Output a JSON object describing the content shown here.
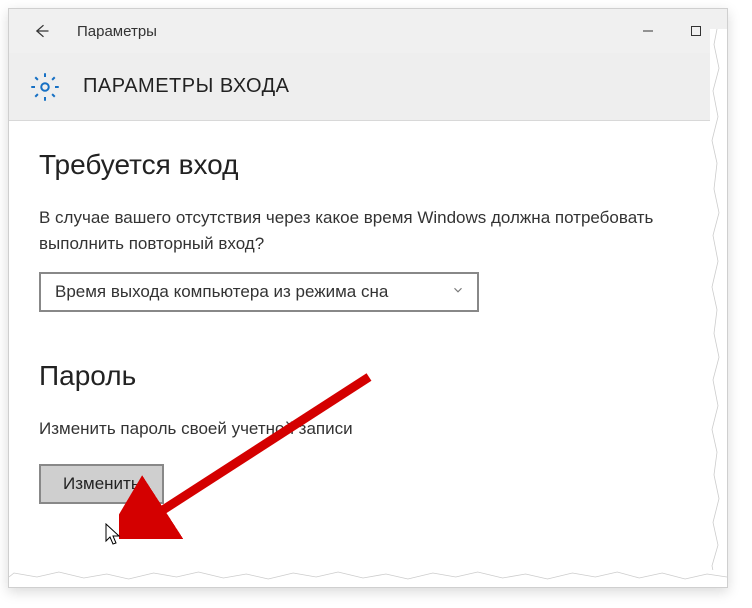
{
  "titlebar": {
    "title": "Параметры"
  },
  "header": {
    "title": "ПАРАМЕТРЫ ВХОДА"
  },
  "signin_required": {
    "title": "Требуется вход",
    "desc": "В случае вашего отсутствия через какое время Windows должна потребовать выполнить повторный вход?",
    "dropdown_value": "Время выхода компьютера из режима сна"
  },
  "password": {
    "title": "Пароль",
    "desc": "Изменить пароль своей учетной записи",
    "button_label": "Изменить"
  }
}
